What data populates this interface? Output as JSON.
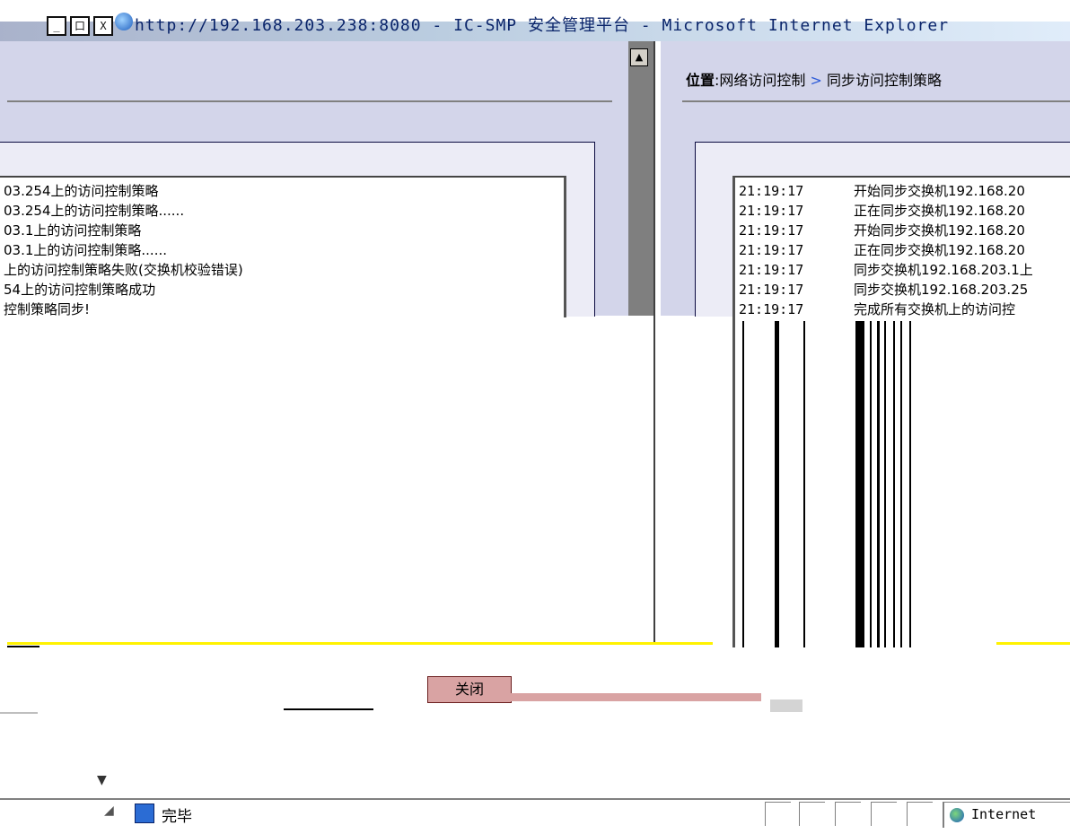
{
  "window": {
    "title": "http://192.168.203.238:8080 - IC-SMP 安全管理平台 - Microsoft Internet Explorer",
    "buttons": [
      "_",
      "口",
      "X"
    ]
  },
  "breadcrumb": {
    "prefix": "位置",
    "colon": ":",
    "level1": "网络访问控制",
    "separator": ">",
    "level2": "同步访问控制策略"
  },
  "left_log": {
    "lines": [
      "03.254上的访问控制策略",
      "03.254上的访问控制策略......",
      "03.1上的访问控制策略",
      "03.1上的访问控制策略......",
      "上的访问控制策略失败(交换机校验错误)",
      "54上的访问控制策略成功",
      "控制策略同步!"
    ]
  },
  "right_log": {
    "rows": [
      {
        "time": "21:19:17",
        "msg": "开始同步交换机192.168.20"
      },
      {
        "time": "21:19:17",
        "msg": "正在同步交换机192.168.20"
      },
      {
        "time": "21:19:17",
        "msg": "开始同步交换机192.168.20"
      },
      {
        "time": "21:19:17",
        "msg": "正在同步交换机192.168.20"
      },
      {
        "time": "21:19:17",
        "msg": "同步交换机192.168.203.1上"
      },
      {
        "time": "21:19:17",
        "msg": "同步交换机192.168.203.25"
      },
      {
        "time": "21:19:17",
        "msg": "完成所有交换机上的访问控"
      }
    ]
  },
  "close_button": {
    "label": "关闭"
  },
  "statusbar": {
    "status": "完毕",
    "zone": "Internet"
  }
}
